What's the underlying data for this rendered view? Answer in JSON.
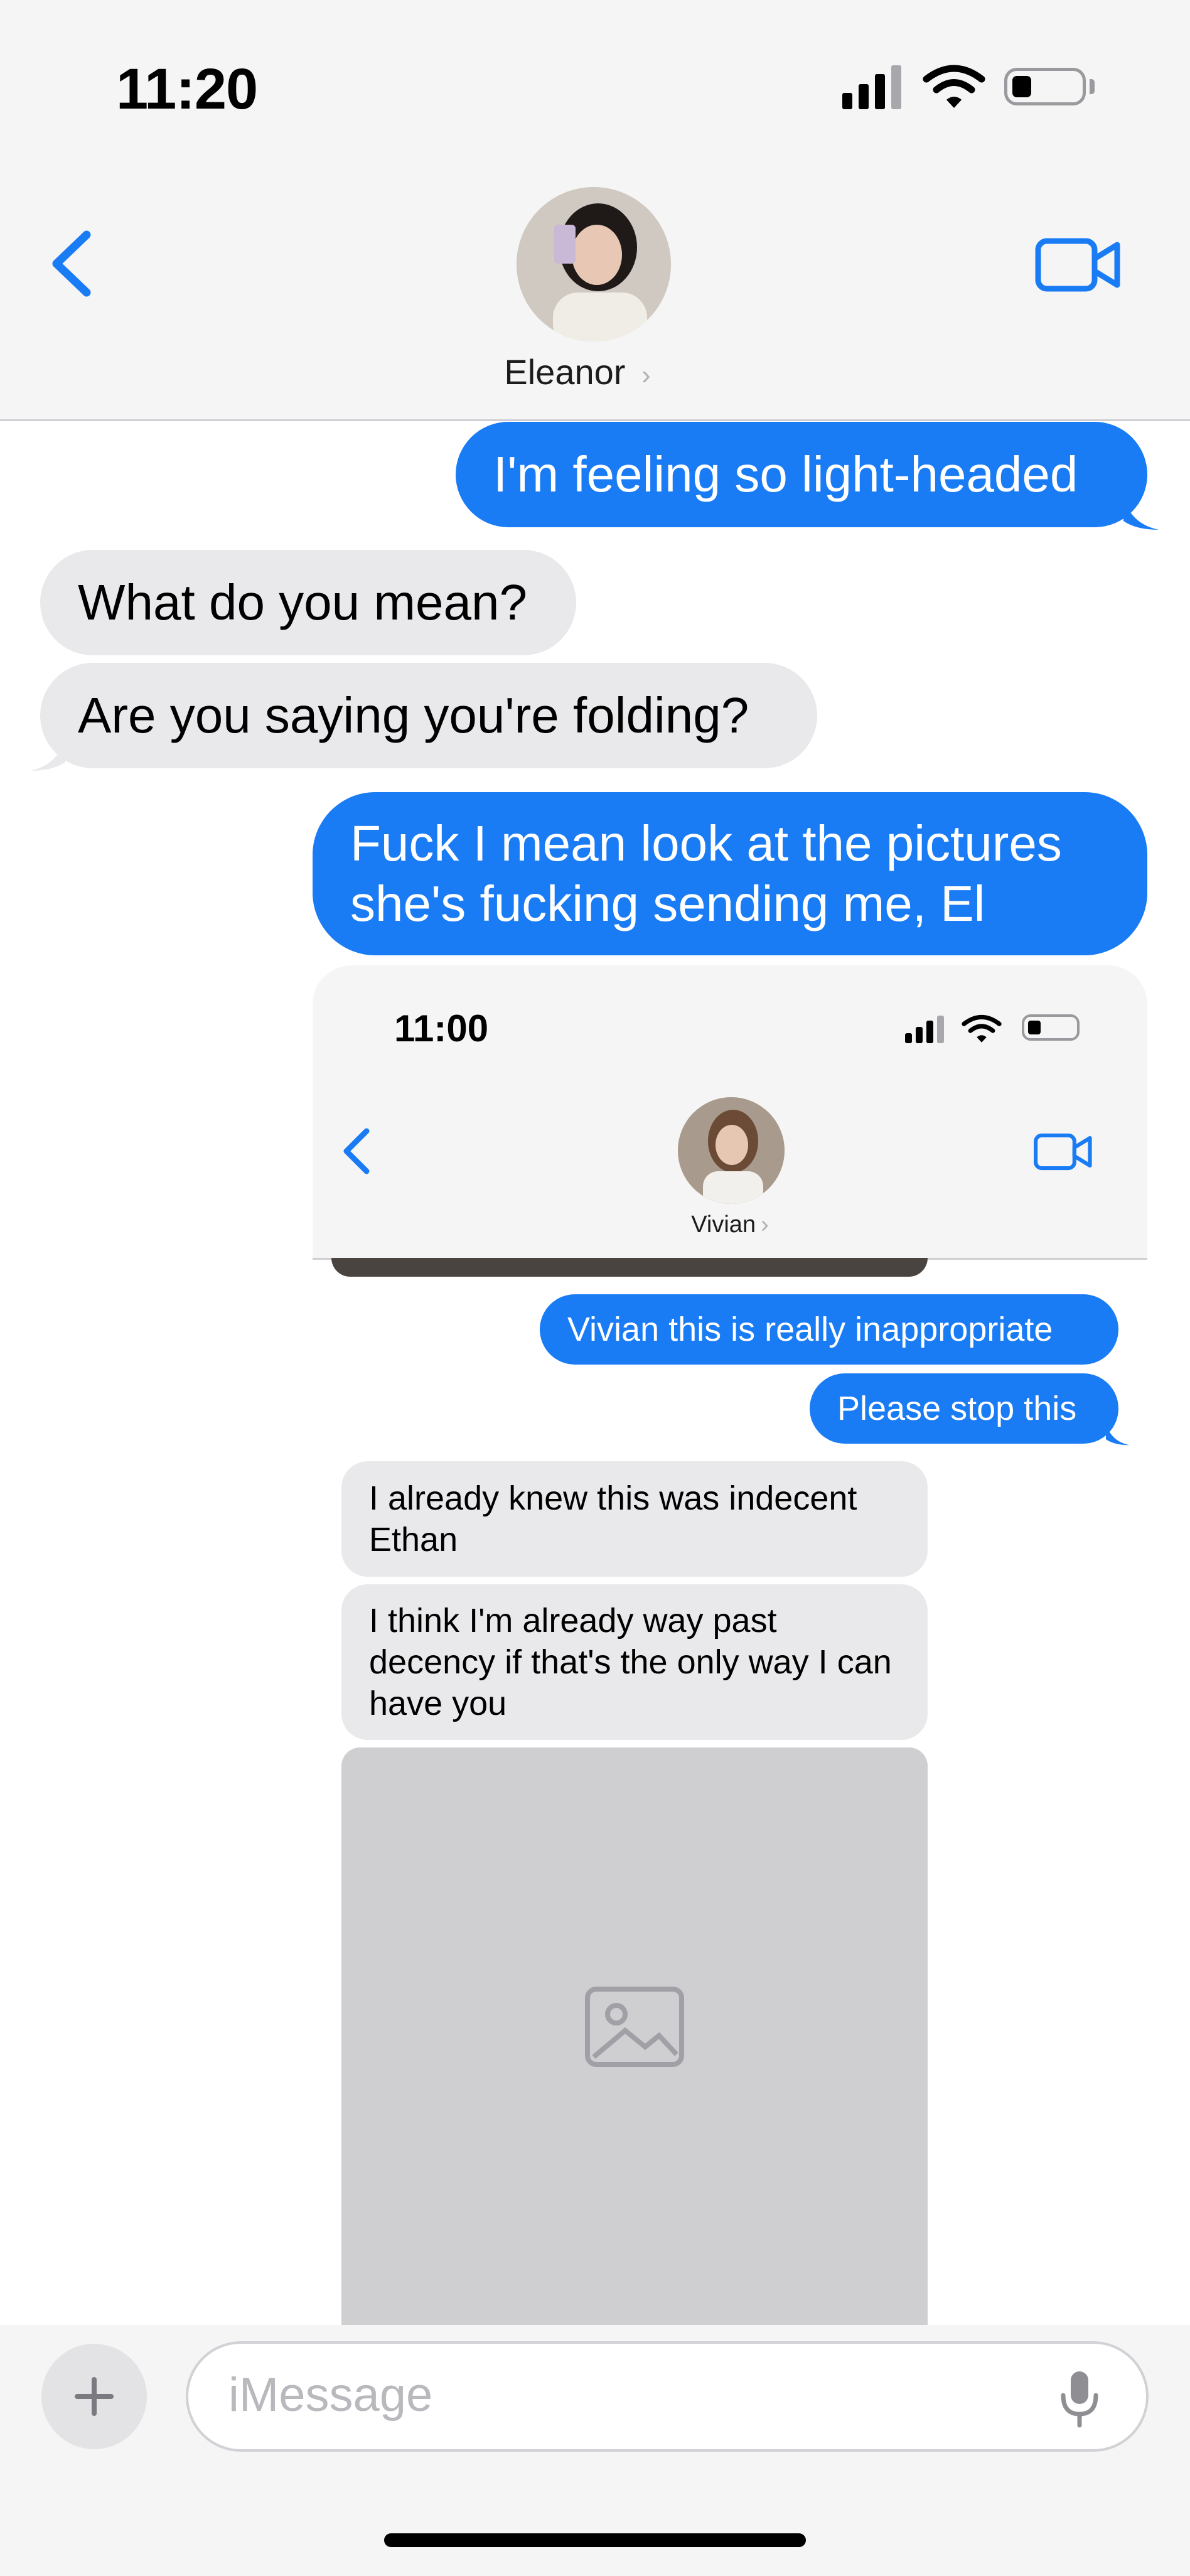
{
  "status_bar": {
    "time": "11:20"
  },
  "header": {
    "contact_name": "Eleanor"
  },
  "messages": [
    {
      "from": "me",
      "text": "I'm feeling so light-headed"
    },
    {
      "from": "them",
      "text": "What do you mean?"
    },
    {
      "from": "them",
      "text": "Are you saying you're folding?"
    },
    {
      "from": "me",
      "text": "Fuck I mean look at the pictures she's fucking sending me, El"
    }
  ],
  "embedded_screenshot": {
    "status_time": "11:00",
    "contact_name": "Vivian",
    "messages": [
      {
        "from": "me",
        "text": "Vivian this is really inappropriate"
      },
      {
        "from": "me",
        "text": "Please stop this"
      },
      {
        "from": "them",
        "text": "I already knew this was indecent Ethan"
      },
      {
        "from": "them",
        "text": "I think I'm already way past decency if that's the only way I can have you"
      }
    ]
  },
  "composer": {
    "placeholder": "iMessage"
  },
  "icons": {
    "back": "chevron-left-icon",
    "video": "video-camera-icon",
    "plus": "plus-icon",
    "mic": "microphone-icon"
  },
  "colors": {
    "accent": "#1a7cf5",
    "outgoing_bubble": "#1a7cf5",
    "incoming_bubble": "#e9e9eb",
    "header_bg": "#f5f5f5"
  }
}
